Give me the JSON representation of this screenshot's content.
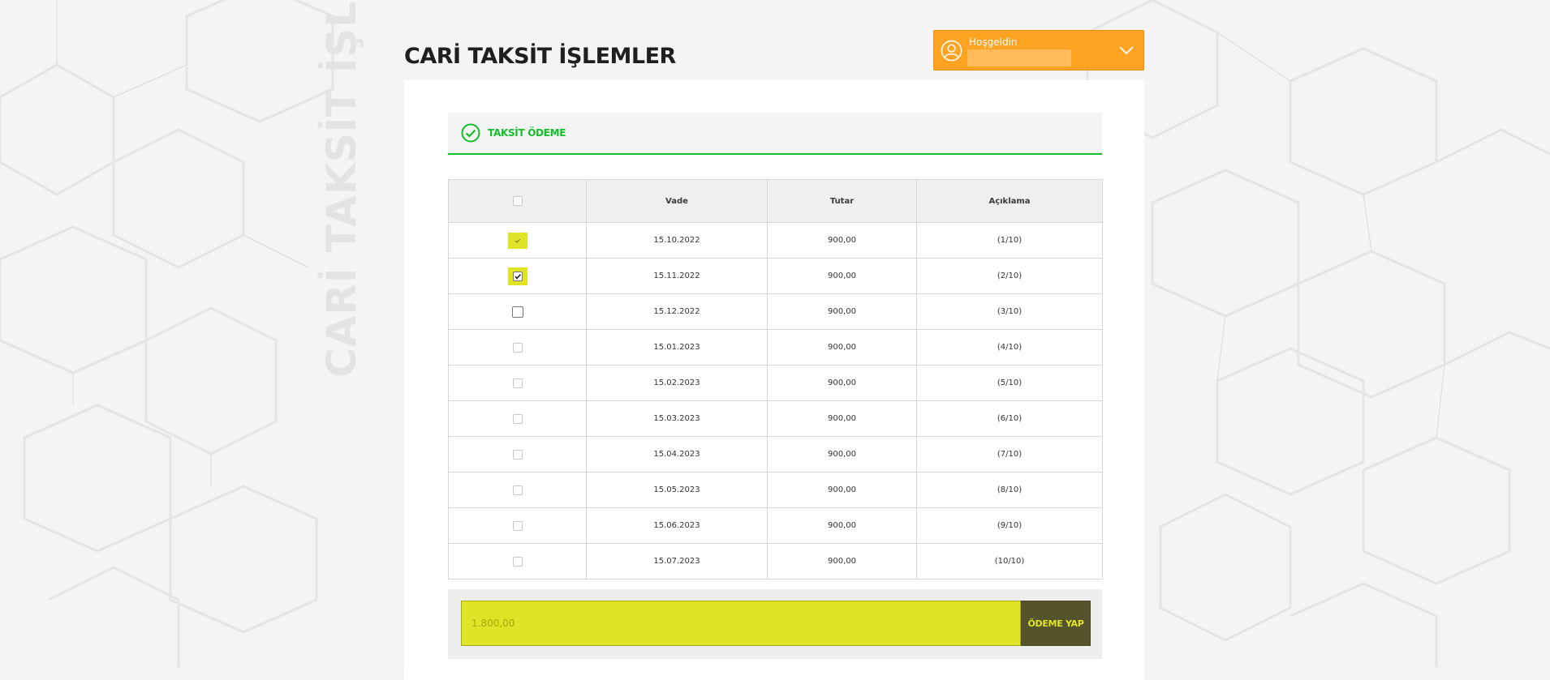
{
  "watermark": "CARİ TAKSİT İŞL",
  "page": {
    "title": "CARİ TAKSİT İŞLEMLER"
  },
  "user": {
    "welcome": "Hoşgeldin",
    "avatar_icon": "user-circle-icon",
    "dropdown_icon": "chevron-down-icon",
    "accent": "#fea422"
  },
  "section": {
    "title": "TAKSİT ÖDEME",
    "icon": "check-circle-icon",
    "accent": "#12bf2a"
  },
  "table": {
    "columns": [
      "",
      "Vade",
      "Tutar",
      "Açıklama"
    ],
    "rows": [
      {
        "checked": true,
        "vade": "15.10.2022",
        "tutar": "900,00",
        "aciklama": "(1/10)"
      },
      {
        "checked": true,
        "vade": "15.11.2022",
        "tutar": "900,00",
        "aciklama": "(2/10)"
      },
      {
        "checked": false,
        "vade": "15.12.2022",
        "tutar": "900,00",
        "aciklama": "(3/10)"
      },
      {
        "checked": false,
        "vade": "15.01.2023",
        "tutar": "900,00",
        "aciklama": "(4/10)"
      },
      {
        "checked": false,
        "vade": "15.02.2023",
        "tutar": "900,00",
        "aciklama": "(5/10)"
      },
      {
        "checked": false,
        "vade": "15.03.2023",
        "tutar": "900,00",
        "aciklama": "(6/10)"
      },
      {
        "checked": false,
        "vade": "15.04.2023",
        "tutar": "900,00",
        "aciklama": "(7/10)"
      },
      {
        "checked": false,
        "vade": "15.05.2023",
        "tutar": "900,00",
        "aciklama": "(8/10)"
      },
      {
        "checked": false,
        "vade": "15.06.2023",
        "tutar": "900,00",
        "aciklama": "(9/10)"
      },
      {
        "checked": false,
        "vade": "15.07.2023",
        "tutar": "900,00",
        "aciklama": "(10/10)"
      }
    ]
  },
  "payment": {
    "amount": "1.800,00",
    "button_label": "ÖDEME YAP",
    "highlight": "#dfe526"
  }
}
